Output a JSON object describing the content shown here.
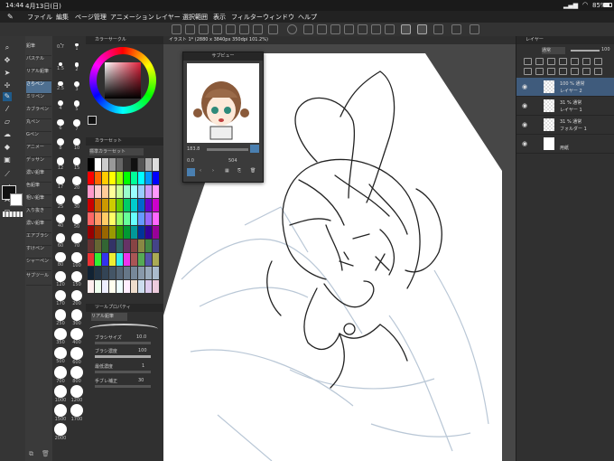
{
  "status": {
    "time": "14:44",
    "date": "4月13日(日)",
    "battery": "85%"
  },
  "menu": [
    "ファイル",
    "編集",
    "ページ管理",
    "アニメーション",
    "レイヤー",
    "選択範囲",
    "表示",
    "フィルター",
    "ウィンドウ",
    "ヘルプ"
  ],
  "subtools": [
    "鉛筆",
    "パステル",
    "リアル鉛筆",
    "さらぺン",
    "ミリペン",
    "カブラペン",
    "丸ペン",
    "Gペン",
    "アニメー",
    "デッサン",
    "濃い鉛筆",
    "色鉛筆",
    "粗い鉛筆",
    "入り抜き",
    "濃い鉛筆",
    "エアブラシ",
    "すけペン",
    "シャーペン",
    "サブツール"
  ],
  "brush_sizes": [
    "0.7",
    "1",
    "1.5",
    "2",
    "2.5",
    "3",
    "4",
    "5",
    "6",
    "7",
    "8",
    "10",
    "12",
    "15",
    "17",
    "20",
    "25",
    "30",
    "40",
    "50",
    "60",
    "70",
    "80",
    "100",
    "120",
    "150",
    "170",
    "200",
    "250",
    "300",
    "350",
    "400",
    "500",
    "600",
    "700",
    "800",
    "1000",
    "1200",
    "1500",
    "1700",
    "2000"
  ],
  "color_panels": {
    "color_circle": "カラーサークル",
    "color_set": "カラーセット",
    "color_set_name": "標準カラーセット",
    "tool_property": "ツールプロパティ",
    "tool_header": "リアル鉛筆"
  },
  "tool_property": {
    "brush_size": {
      "label": "ブラシサイズ",
      "value": "10.0"
    },
    "brush_density": {
      "label": "ブラシ濃度",
      "value": "100"
    },
    "min_density": {
      "label": "最低濃度",
      "value": "1"
    },
    "stabilization": {
      "label": "手ブレ補正",
      "value": "30"
    }
  },
  "canvas": {
    "tab_title": "イラスト 1* (2880 x 3840px 350dpi 101.2%)"
  },
  "navigator": {
    "title": "サブビュー",
    "zoom": "183.8",
    "angle": "0.0",
    "value": "504"
  },
  "layers": {
    "panel_title": "レイヤー",
    "blend_mode": "通常",
    "opacity": "100",
    "items": [
      {
        "percent": "100 %",
        "mode": "通常",
        "name": "レイヤー 2",
        "selected": true
      },
      {
        "percent": "31 %",
        "mode": "通常",
        "name": "レイヤー 1",
        "selected": false
      },
      {
        "percent": "31 %",
        "mode": "通常",
        "name": "フォルダー 1",
        "selected": false
      },
      {
        "percent": "",
        "mode": "",
        "name": "用紙",
        "selected": false
      }
    ]
  },
  "colors": {
    "accent": "#1e5a8a",
    "selected_layer": "#3f5b7c",
    "panel": "#303030",
    "canvas_bg": "#474747"
  }
}
